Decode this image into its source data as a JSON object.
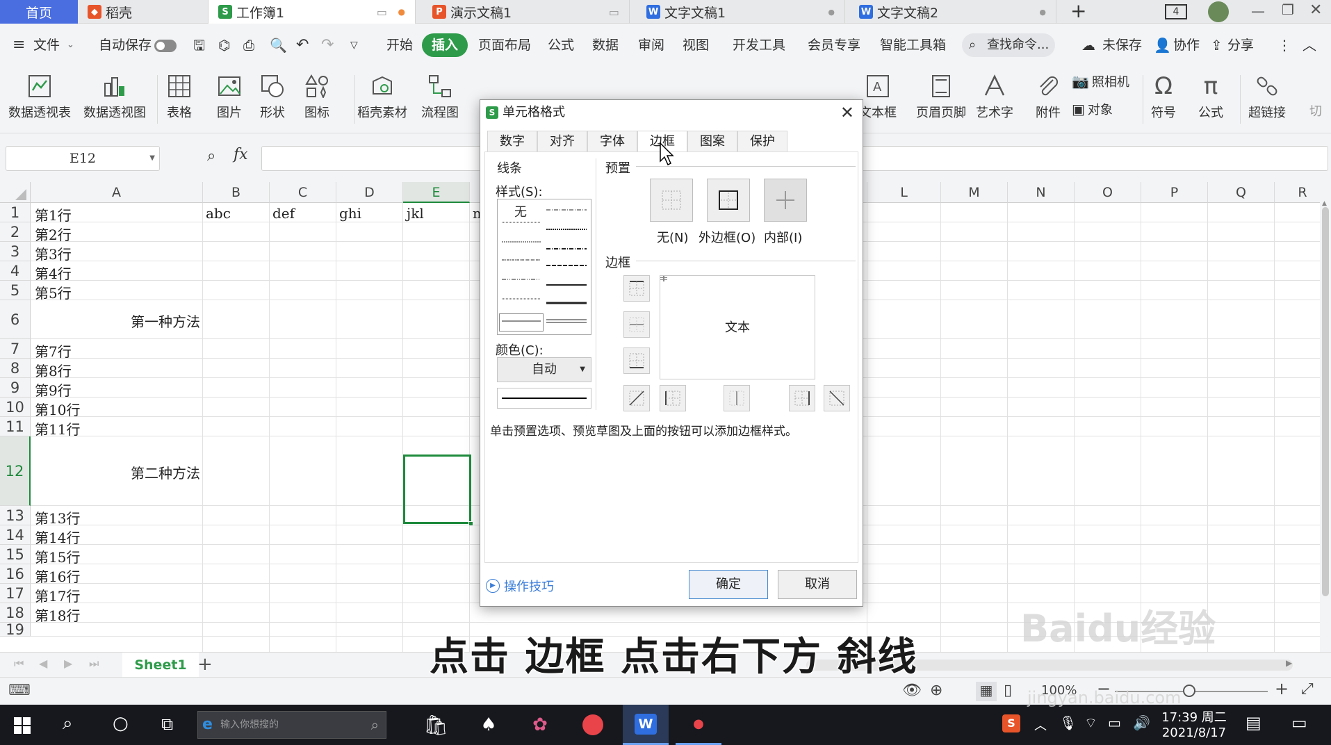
{
  "tabs": {
    "home": "首页",
    "daoke": "稻壳",
    "workbook": "工作簿1",
    "presentation": "演示文稿1",
    "doc1": "文字文稿1",
    "doc2": "文字文稿2",
    "new_tab": "+",
    "badge": "4"
  },
  "menu": {
    "file": "文件",
    "autosave": "自动保存",
    "start": "开始",
    "insert": "插入",
    "page_layout": "页面布局",
    "formula": "公式",
    "data": "数据",
    "review": "审阅",
    "view": "视图",
    "developer": "开发工具",
    "member": "会员专享",
    "smart_tools": "智能工具箱",
    "search": "查找命令...",
    "unsaved": "未保存",
    "collab": "协作",
    "share": "分享"
  },
  "ribbon": {
    "pivot_table": "数据透视表",
    "pivot_chart": "数据透视图",
    "table": "表格",
    "picture": "图片",
    "shape": "形状",
    "icon": "图标",
    "daoke_material": "稻壳素材",
    "flowchart": "流程图",
    "textbox": "文本框",
    "header_footer": "页眉页脚",
    "wordart": "艺术字",
    "attachment": "附件",
    "camera": "照相机",
    "object": "对象",
    "symbol": "符号",
    "equation": "公式",
    "hyperlink": "超链接",
    "cut_off": "切"
  },
  "formula_bar": {
    "name_box": "E12",
    "fx": "fx"
  },
  "columns": [
    "A",
    "B",
    "C",
    "D",
    "E",
    "L",
    "M",
    "N",
    "O",
    "P",
    "Q",
    "R"
  ],
  "rows": [
    {
      "num": "1",
      "a": "第1行"
    },
    {
      "num": "2",
      "a": "第2行"
    },
    {
      "num": "3",
      "a": "第3行"
    },
    {
      "num": "4",
      "a": "第4行"
    },
    {
      "num": "5",
      "a": "第5行"
    },
    {
      "num": "6",
      "a": "第一种方法"
    },
    {
      "num": "7",
      "a": "第7行"
    },
    {
      "num": "8",
      "a": "第8行"
    },
    {
      "num": "9",
      "a": "第9行"
    },
    {
      "num": "10",
      "a": "第10行"
    },
    {
      "num": "11",
      "a": "第11行"
    },
    {
      "num": "12",
      "a": "第二种方法"
    },
    {
      "num": "13",
      "a": "第13行"
    },
    {
      "num": "14",
      "a": "第14行"
    },
    {
      "num": "15",
      "a": "第15行"
    },
    {
      "num": "16",
      "a": "第16行"
    },
    {
      "num": "17",
      "a": "第17行"
    },
    {
      "num": "18",
      "a": "第18行"
    },
    {
      "num": "19",
      "a": ""
    }
  ],
  "row1_cells": {
    "b": "abc",
    "c": "def",
    "d": "ghi",
    "e": "jkl",
    "f": "m"
  },
  "sheet": {
    "name": "Sheet1",
    "add": "+"
  },
  "status": {
    "zoom": "100%"
  },
  "taskbar": {
    "search_placeholder": "输入你想搜的",
    "time": "17:39 周二",
    "date": "2021/8/17"
  },
  "dialog": {
    "title": "单元格格式",
    "tabs": [
      "数字",
      "对齐",
      "字体",
      "边框",
      "图案",
      "保护"
    ],
    "active_tab": "边框",
    "line_group": "线条",
    "style_label": "样式(S):",
    "style_none": "无",
    "color_label": "颜色(C):",
    "color_value": "自动",
    "preset_group": "预置",
    "preset_none": "无(N)",
    "preset_outline": "外边框(O)",
    "preset_inside": "内部(I)",
    "border_group": "边框",
    "preview_text": "文本",
    "hint": "单击预置选项、预览草图及上面的按钮可以添加边框样式。",
    "tips": "操作技巧",
    "ok": "确定",
    "cancel": "取消"
  },
  "overlay": {
    "subtitle": "点击 边框 点击右下方 斜线",
    "watermark": "Baidu经验",
    "watermark_url": "jingyan.baidu.com"
  },
  "colors": {
    "accent_green": "#2e9b4a",
    "home_tab_blue": "#4a6ee0",
    "selection": "#1e8a3c"
  }
}
